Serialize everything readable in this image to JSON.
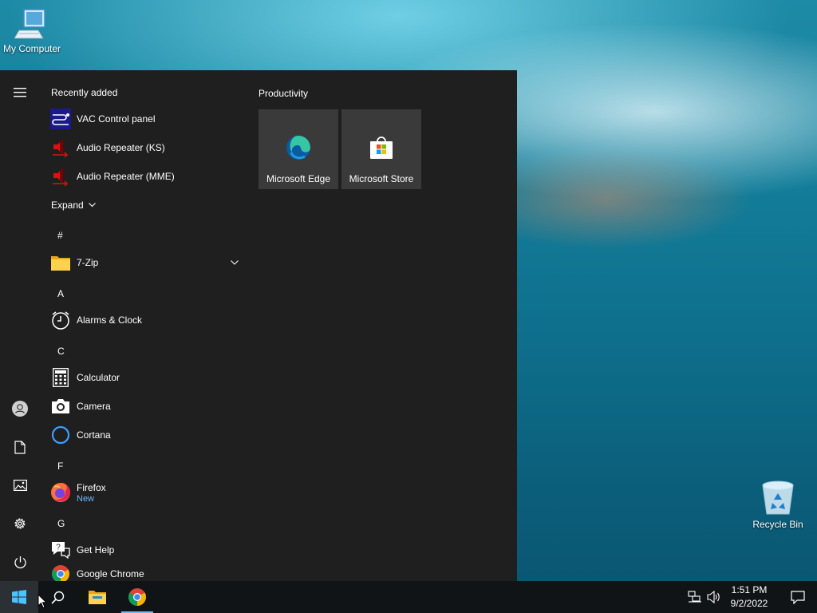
{
  "desktop": {
    "my_computer": "My Computer",
    "recycle_bin": "Recycle Bin"
  },
  "start_menu": {
    "recently_added": "Recently added",
    "recent_apps": [
      {
        "label": "VAC Control panel",
        "icon": "vac-control-icon"
      },
      {
        "label": "Audio Repeater (KS)",
        "icon": "speaker-icon"
      },
      {
        "label": "Audio Repeater (MME)",
        "icon": "speaker-icon"
      }
    ],
    "expand": "Expand",
    "letters": {
      "hash": "#",
      "a": "A",
      "c": "C",
      "f": "F",
      "g": "G"
    },
    "apps": {
      "zip": "7-Zip",
      "alarms": "Alarms & Clock",
      "calculator": "Calculator",
      "camera": "Camera",
      "cortana": "Cortana",
      "firefox": "Firefox",
      "firefox_badge": "New",
      "gethelp": "Get Help",
      "chrome": "Google Chrome"
    },
    "tile_group": "Productivity",
    "tiles": [
      {
        "label": "Microsoft Edge",
        "icon": "edge-icon"
      },
      {
        "label": "Microsoft Store",
        "icon": "store-icon"
      }
    ]
  },
  "taskbar": {
    "time": "1:51 PM",
    "date": "9/2/2022"
  },
  "colors": {
    "start_bg": "#1f1f1f",
    "tile_bg": "#3a3a3a",
    "taskbar_bg": "#101417",
    "accent": "#76b9ed"
  }
}
